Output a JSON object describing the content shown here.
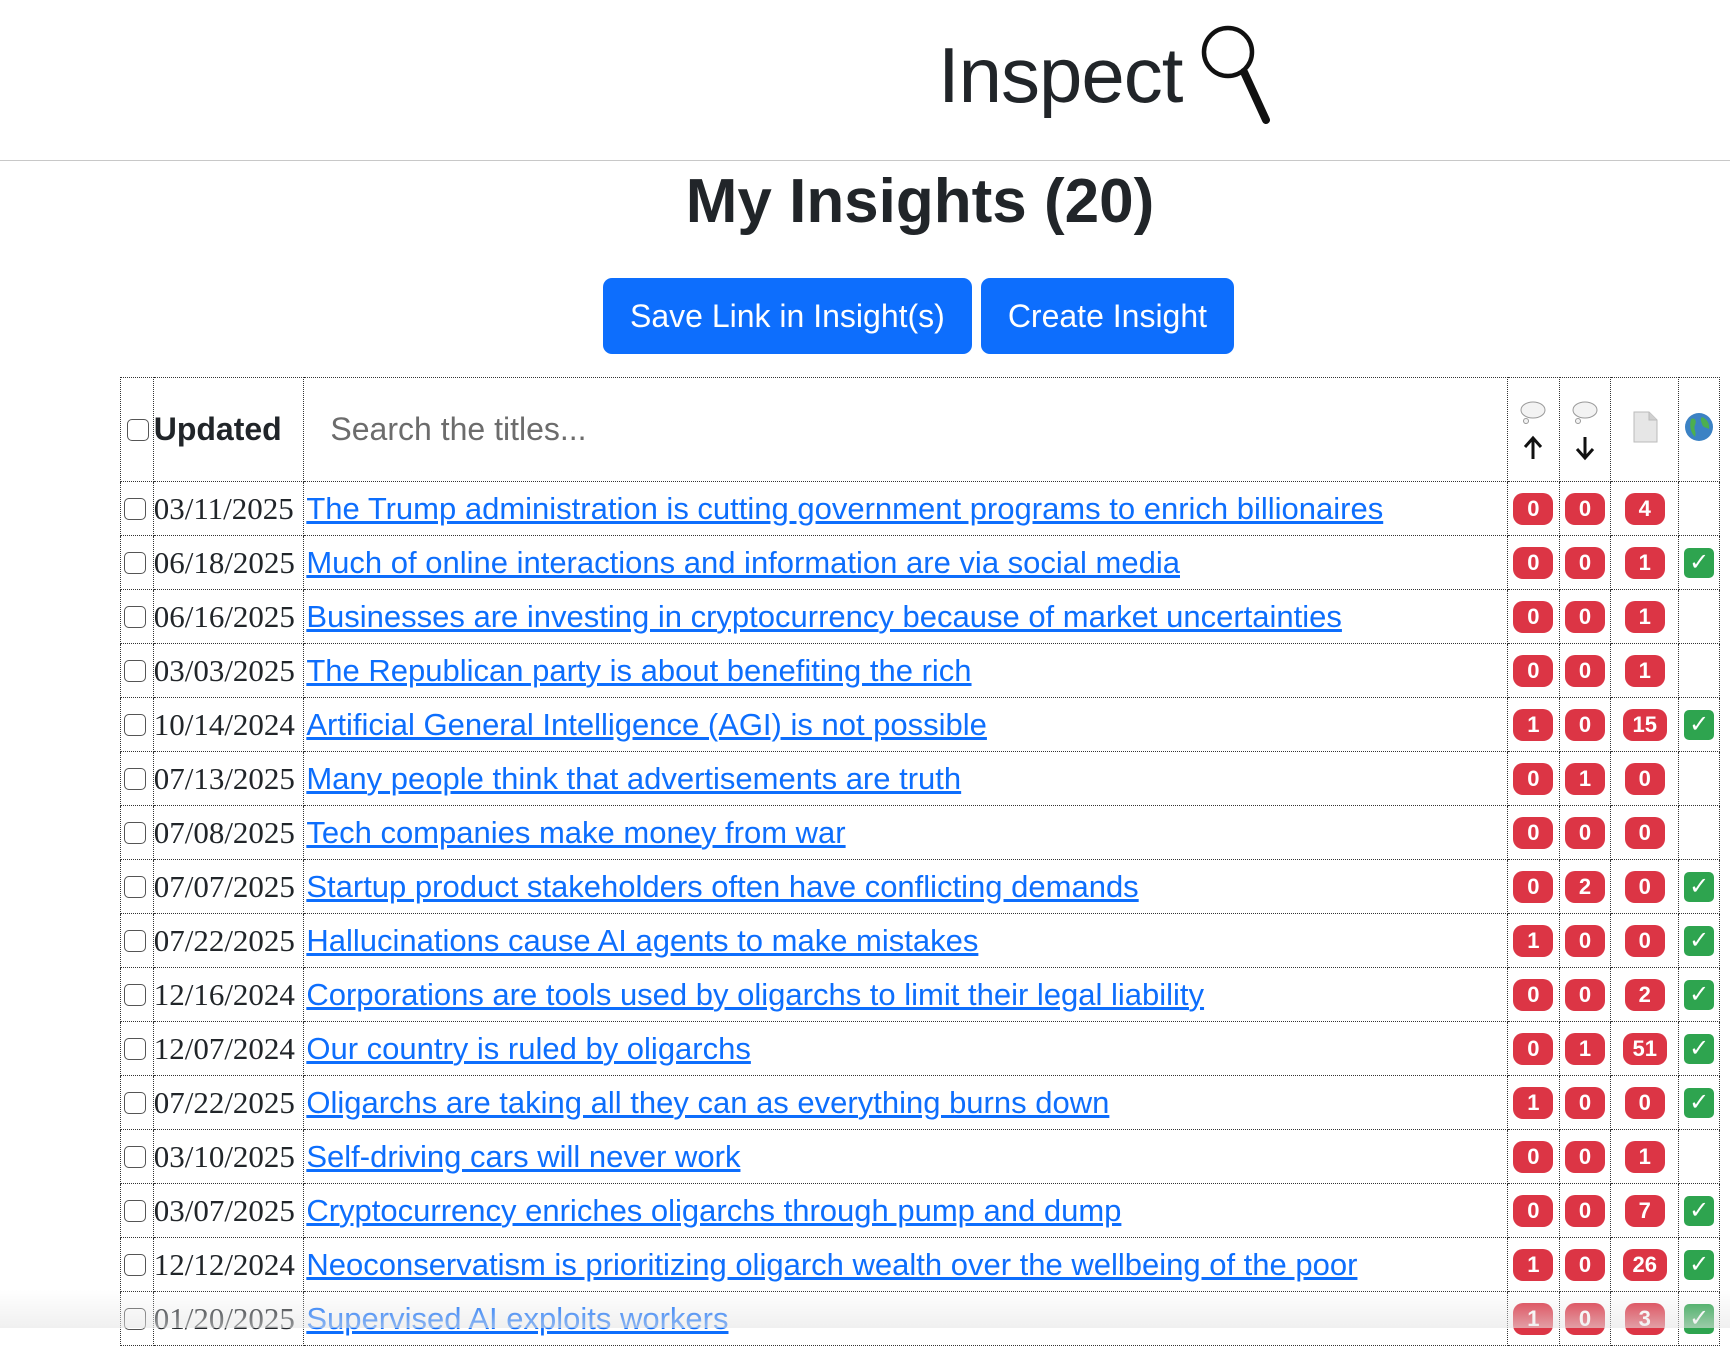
{
  "brand": {
    "name": "Inspect",
    "icon": "magnifying-glass-icon"
  },
  "page": {
    "title": "My Insights (20)"
  },
  "buttons": {
    "save_link": "Save Link in Insight(s)",
    "create_insight": "Create Insight"
  },
  "table": {
    "header": {
      "updated": "Updated",
      "search_placeholder": "Search the titles...",
      "icons": [
        "thought-bubble-up-icon",
        "thought-bubble-down-icon",
        "document-icon",
        "globe-icon"
      ]
    },
    "rows": [
      {
        "date": "03/11/2025",
        "title": "The Trump administration is cutting government programs to enrich billionaires",
        "up": "0",
        "down": "0",
        "links": "4",
        "published": false
      },
      {
        "date": "06/18/2025",
        "title": "Much of online interactions and information are via social media",
        "up": "0",
        "down": "0",
        "links": "1",
        "published": true
      },
      {
        "date": "06/16/2025",
        "title": "Businesses are investing in cryptocurrency because of market uncertainties",
        "up": "0",
        "down": "0",
        "links": "1",
        "published": false
      },
      {
        "date": "03/03/2025",
        "title": "The Republican party is about benefiting the rich",
        "up": "0",
        "down": "0",
        "links": "1",
        "published": false
      },
      {
        "date": "10/14/2024",
        "title": "Artificial General Intelligence (AGI) is not possible",
        "up": "1",
        "down": "0",
        "links": "15",
        "published": true
      },
      {
        "date": "07/13/2025",
        "title": "Many people think that advertisements are truth",
        "up": "0",
        "down": "1",
        "links": "0",
        "published": false
      },
      {
        "date": "07/08/2025",
        "title": "Tech companies make money from war",
        "up": "0",
        "down": "0",
        "links": "0",
        "published": false
      },
      {
        "date": "07/07/2025",
        "title": "Startup product stakeholders often have conflicting demands",
        "up": "0",
        "down": "2",
        "links": "0",
        "published": true
      },
      {
        "date": "07/22/2025",
        "title": "Hallucinations cause AI agents to make mistakes",
        "up": "1",
        "down": "0",
        "links": "0",
        "published": true
      },
      {
        "date": "12/16/2024",
        "title": "Corporations are tools used by oligarchs to limit their legal liability",
        "up": "0",
        "down": "0",
        "links": "2",
        "published": true
      },
      {
        "date": "12/07/2024",
        "title": "Our country is ruled by oligarchs",
        "up": "0",
        "down": "1",
        "links": "51",
        "published": true
      },
      {
        "date": "07/22/2025",
        "title": "Oligarchs are taking all they can as everything burns down",
        "up": "1",
        "down": "0",
        "links": "0",
        "published": true
      },
      {
        "date": "03/10/2025",
        "title": "Self-driving cars will never work",
        "up": "0",
        "down": "0",
        "links": "1",
        "published": false
      },
      {
        "date": "03/07/2025",
        "title": "Cryptocurrency enriches oligarchs through pump and dump",
        "up": "0",
        "down": "0",
        "links": "7",
        "published": true
      },
      {
        "date": "12/12/2024",
        "title": "Neoconservatism is prioritizing oligarch wealth over the wellbeing of the poor",
        "up": "1",
        "down": "0",
        "links": "26",
        "published": true
      },
      {
        "date": "01/20/2025",
        "title": "Supervised AI exploits workers",
        "up": "1",
        "down": "0",
        "links": "3",
        "published": true
      }
    ]
  },
  "colors": {
    "primary": "#0d6efd",
    "badge": "#dc3545",
    "published": "#2ea44f",
    "link": "#0d6efd"
  }
}
